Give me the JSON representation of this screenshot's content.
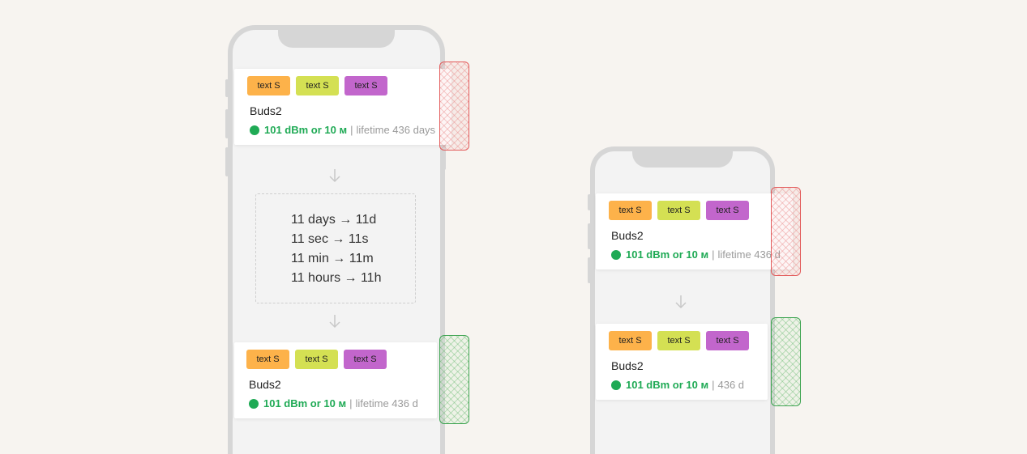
{
  "colors": {
    "chip_orange": "#fdb24a",
    "chip_lime": "#d4e053",
    "chip_purple": "#c266cc",
    "signal_green": "#1faa55",
    "bad_marker": "#e35b5b",
    "good_marker": "#3fa452"
  },
  "chip_label": "text S",
  "device_name": "Buds2",
  "signal_text": "101 dBm or 10 м",
  "separator": "|",
  "left_phone": {
    "top_card": {
      "lifetime": "lifetime 436 days"
    },
    "conversions": [
      "11 days → 11d",
      "11 sec → 11s",
      "11 min → 11m",
      "11 hours → 11h"
    ],
    "bottom_card": {
      "lifetime": "lifetime 436 d"
    }
  },
  "right_phone": {
    "top_card": {
      "lifetime": "lifetime 436 d"
    },
    "bottom_card": {
      "lifetime": "436 d"
    }
  },
  "icons": {
    "arrow": "arrow-down-icon"
  }
}
